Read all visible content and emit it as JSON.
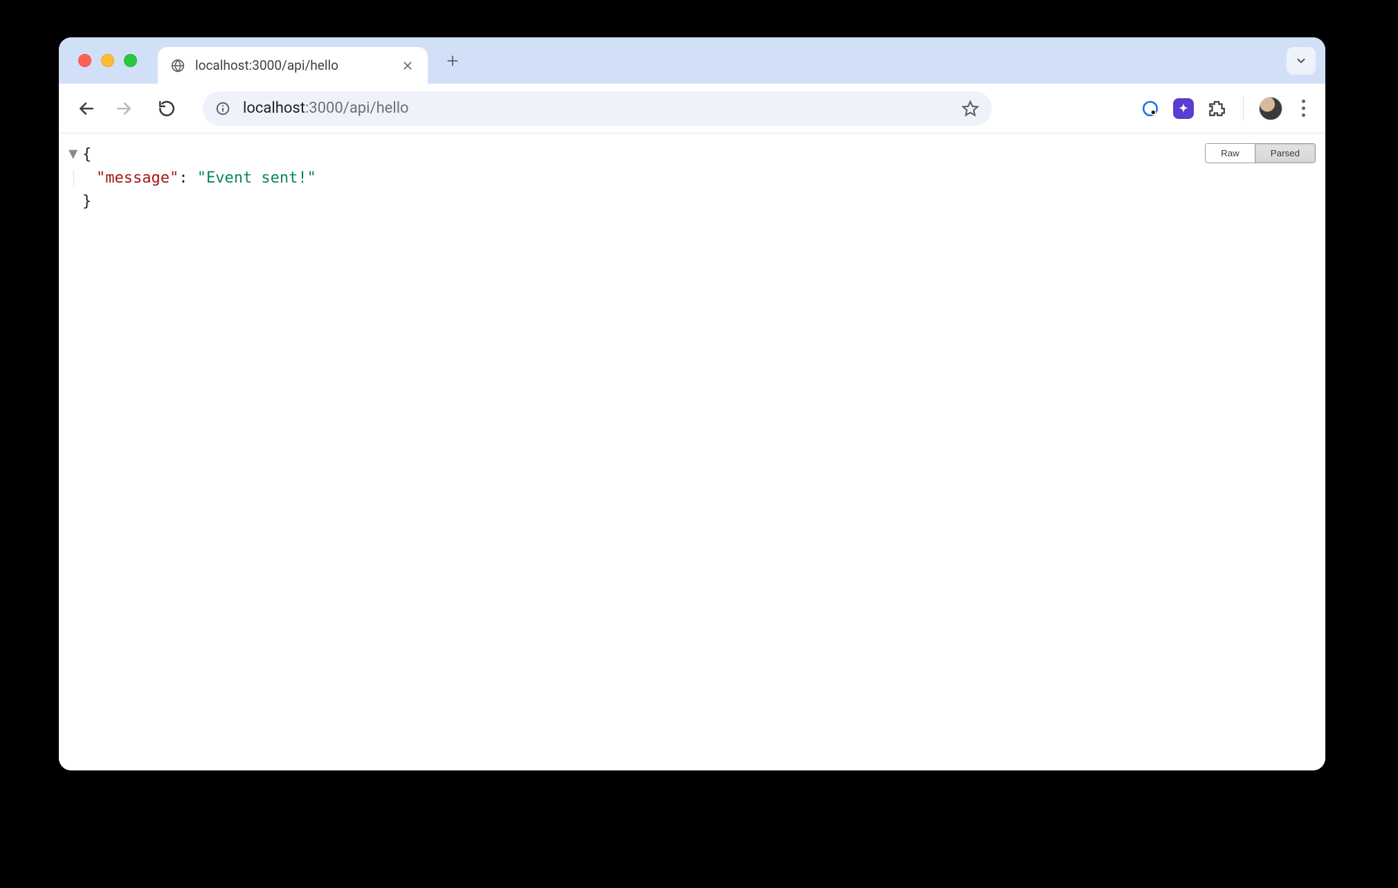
{
  "tab": {
    "title": "localhost:3000/api/hello"
  },
  "address": {
    "host": "localhost",
    "path": ":3000/api/hello"
  },
  "viewer": {
    "toggle": {
      "raw": "Raw",
      "parsed": "Parsed",
      "active": "parsed"
    },
    "json": {
      "open_brace": "{",
      "close_brace": "}",
      "key_quoted": "\"message\"",
      "colon": ": ",
      "value_quoted": "\"Event sent!\""
    }
  }
}
